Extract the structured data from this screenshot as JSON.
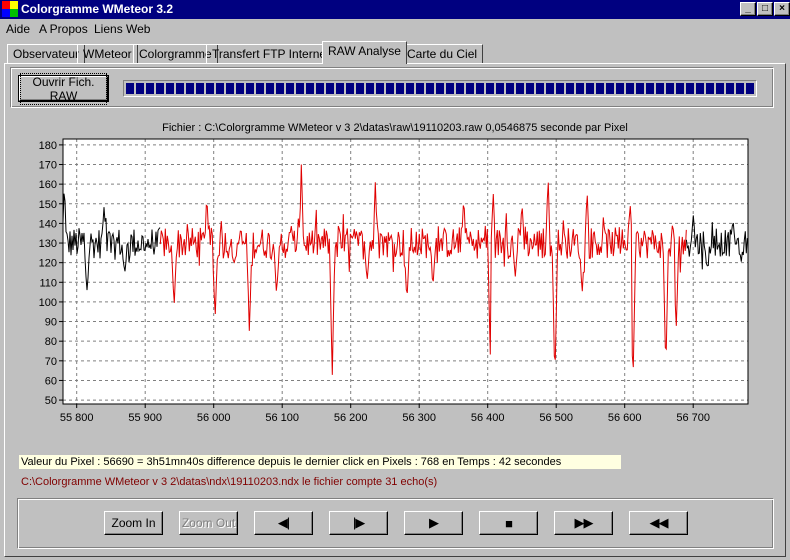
{
  "window": {
    "title": "Colorgramme WMeteor 3.2",
    "buttons": {
      "minimize": "_",
      "maximize": "□",
      "close": "×"
    }
  },
  "menu": [
    "Aide",
    "A Propos",
    "Liens Web"
  ],
  "tabs": [
    {
      "label": "Observateur"
    },
    {
      "label": "WMeteor"
    },
    {
      "label": "Colorgramme"
    },
    {
      "label": "Transfert FTP Internet"
    },
    {
      "label": "RAW Analyse",
      "active": true
    },
    {
      "label": "Carte du Ciel"
    }
  ],
  "toolbar": {
    "open_button": "Ouvrir Fich. RAW",
    "progress_fraction": 1.0,
    "progress_color": "#000080"
  },
  "chart_header": "Fichier : C:\\Colorgramme WMeteor v 3 2\\datas\\raw\\19110203.raw     0,0546875 seconde par Pixel",
  "chart_data": {
    "type": "line",
    "title": "",
    "xlabel": "",
    "ylabel": "",
    "xlim": [
      55780,
      56780
    ],
    "ylim": [
      48,
      183
    ],
    "xticks": [
      55800,
      55900,
      56000,
      56100,
      56200,
      56300,
      56400,
      56500,
      56600,
      56700
    ],
    "xtick_labels": [
      "55 800",
      "55 900",
      "56 000",
      "56 100",
      "56 200",
      "56 300",
      "56 400",
      "56 500",
      "56 600",
      "56 700"
    ],
    "yticks": [
      50,
      60,
      70,
      80,
      90,
      100,
      110,
      120,
      130,
      140,
      150,
      160,
      170,
      180
    ],
    "grid": true,
    "series": [
      {
        "segment": "before-selection",
        "color": "#000000",
        "x_range": [
          55780,
          55922
        ],
        "baseline": 130,
        "noise": 8,
        "dips": [
          {
            "x": 55815,
            "y": 104
          },
          {
            "x": 55870,
            "y": 112
          }
        ],
        "peaks": [
          {
            "x": 55782,
            "y": 160
          },
          {
            "x": 55840,
            "y": 149
          }
        ]
      },
      {
        "segment": "selection",
        "color": "#e00000",
        "x_range": [
          55922,
          56690
        ],
        "baseline": 130,
        "noise": 8,
        "dips": [
          {
            "x": 55942,
            "y": 97
          },
          {
            "x": 56002,
            "y": 92
          },
          {
            "x": 56030,
            "y": 119
          },
          {
            "x": 56052,
            "y": 86
          },
          {
            "x": 56092,
            "y": 103
          },
          {
            "x": 56173,
            "y": 63
          },
          {
            "x": 56224,
            "y": 110
          },
          {
            "x": 56282,
            "y": 100
          },
          {
            "x": 56320,
            "y": 109
          },
          {
            "x": 56404,
            "y": 69
          },
          {
            "x": 56440,
            "y": 113
          },
          {
            "x": 56498,
            "y": 58
          },
          {
            "x": 56538,
            "y": 104
          },
          {
            "x": 56612,
            "y": 57
          },
          {
            "x": 56660,
            "y": 66
          },
          {
            "x": 56675,
            "y": 85
          }
        ],
        "peaks": [
          {
            "x": 55990,
            "y": 155
          },
          {
            "x": 56128,
            "y": 171
          },
          {
            "x": 56236,
            "y": 161
          },
          {
            "x": 56365,
            "y": 154
          },
          {
            "x": 56408,
            "y": 157
          },
          {
            "x": 56450,
            "y": 152
          },
          {
            "x": 56488,
            "y": 165
          },
          {
            "x": 56545,
            "y": 156
          },
          {
            "x": 56608,
            "y": 151
          },
          {
            "x": 56670,
            "y": 139
          }
        ]
      },
      {
        "segment": "after-selection",
        "color": "#000000",
        "x_range": [
          56690,
          56780
        ],
        "baseline": 130,
        "noise": 7,
        "dips": [
          {
            "x": 56720,
            "y": 118
          },
          {
            "x": 56770,
            "y": 120
          }
        ],
        "peaks": [
          {
            "x": 56700,
            "y": 145
          },
          {
            "x": 56758,
            "y": 143
          }
        ]
      }
    ]
  },
  "status": {
    "info": "Valeur du Pixel : 56690 = 3h51mn40s difference depuis le dernier click en Pixels : 768 en Temps : 42 secondes",
    "file": "C:\\Colorgramme WMeteor v 3 2\\datas\\ndx\\19110203.ndx   le fichier compte 31 echo(s)",
    "info_bg": "#ffffe1",
    "file_color": "#800000"
  },
  "controls": {
    "zoom_in": "Zoom In",
    "zoom_out": "Zoom Out",
    "prev": "◀|",
    "next": "|▶",
    "play": "▶",
    "stop": "■",
    "fast_forward": "▶▶",
    "rewind": "◀◀"
  }
}
